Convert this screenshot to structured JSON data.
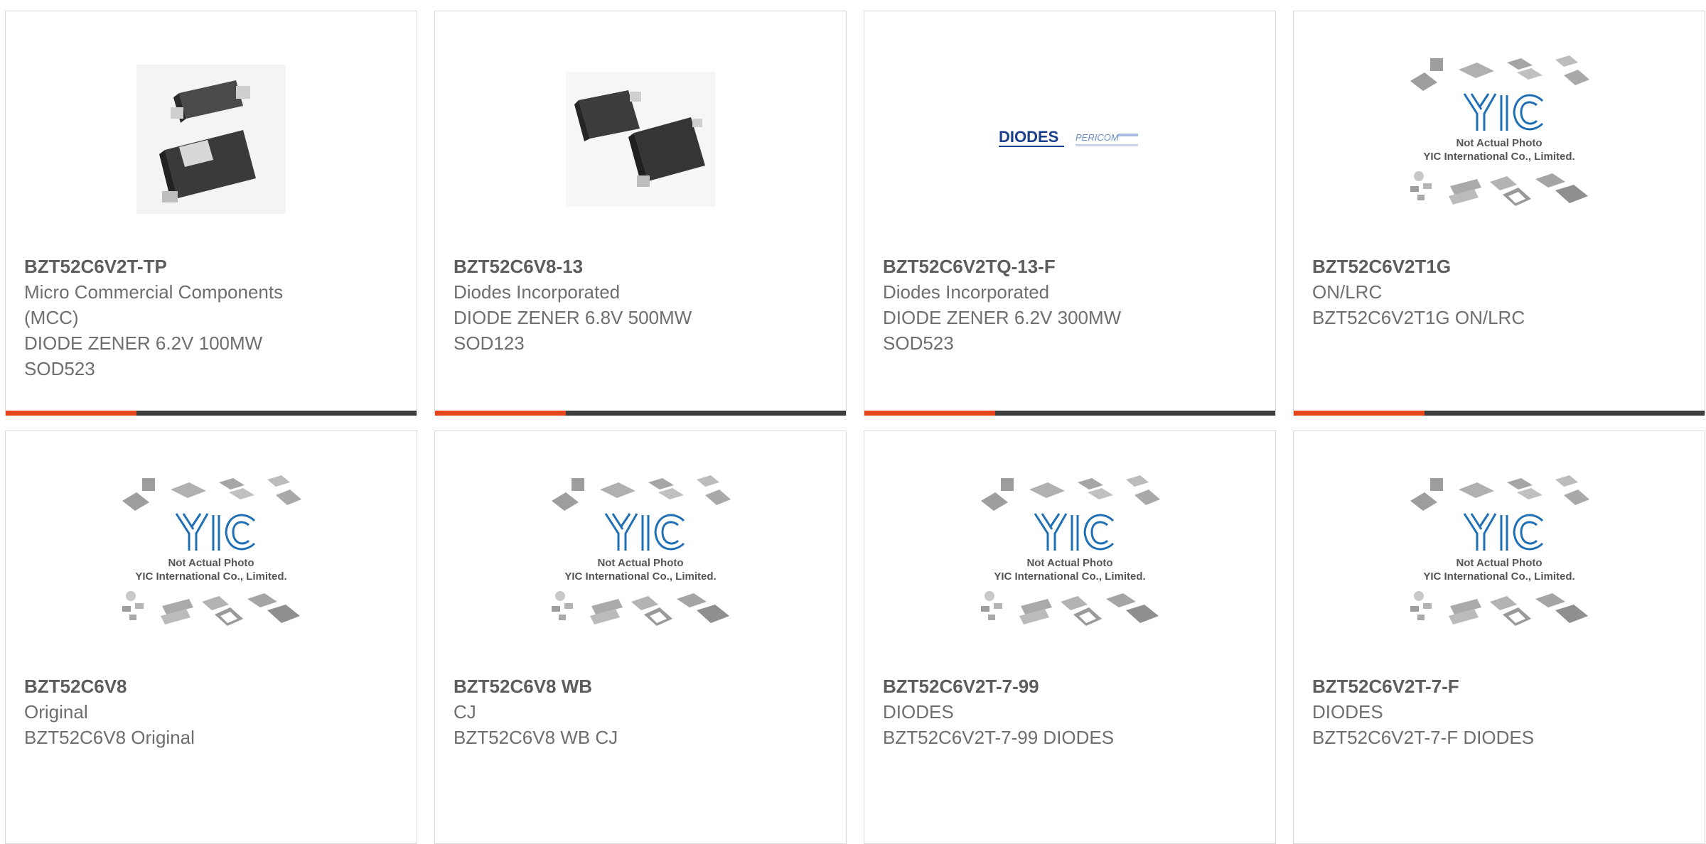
{
  "colors": {
    "accent": "#e8451c",
    "bar_dark": "#3c3c3c",
    "text_dark": "#5c5c5c",
    "text_light": "#6e6e6e",
    "border": "#d9d9d9",
    "yic_blue": "#1f6fb5"
  },
  "placeholder": {
    "line1": "Not Actual Photo",
    "line2": "YIC International Co., Limited.",
    "logo_text": "YIC"
  },
  "diodes_logo": {
    "brand": "DIODES",
    "sub": "PERICOM"
  },
  "products": [
    {
      "part_number": "BZT52C6V2T-TP",
      "manufacturer": "Micro Commercial Components (MCC)",
      "description": "DIODE ZENER 6.2V 100MW SOD523",
      "image": "sod523-package-photo"
    },
    {
      "part_number": "BZT52C6V8-13",
      "manufacturer": "Diodes Incorporated",
      "description": "DIODE ZENER 6.8V 500MW SOD123",
      "image": "sod123-package-photo"
    },
    {
      "part_number": "BZT52C6V2TQ-13-F",
      "manufacturer": "Diodes Incorporated",
      "description": "DIODE ZENER 6.2V 300MW SOD523",
      "image": "diodes-pericom-logo"
    },
    {
      "part_number": "BZT52C6V2T1G",
      "manufacturer": "ON/LRC",
      "description": "BZT52C6V2T1G ON/LRC",
      "image": "yic-placeholder"
    },
    {
      "part_number": "BZT52C6V8",
      "manufacturer": "Original",
      "description": "BZT52C6V8 Original",
      "image": "yic-placeholder"
    },
    {
      "part_number": "BZT52C6V8 WB",
      "manufacturer": "CJ",
      "description": "BZT52C6V8 WB CJ",
      "image": "yic-placeholder"
    },
    {
      "part_number": "BZT52C6V2T-7-99",
      "manufacturer": "DIODES",
      "description": "BZT52C6V2T-7-99 DIODES",
      "image": "yic-placeholder"
    },
    {
      "part_number": "BZT52C6V2T-7-F",
      "manufacturer": "DIODES",
      "description": "BZT52C6V2T-7-F DIODES",
      "image": "yic-placeholder"
    }
  ]
}
